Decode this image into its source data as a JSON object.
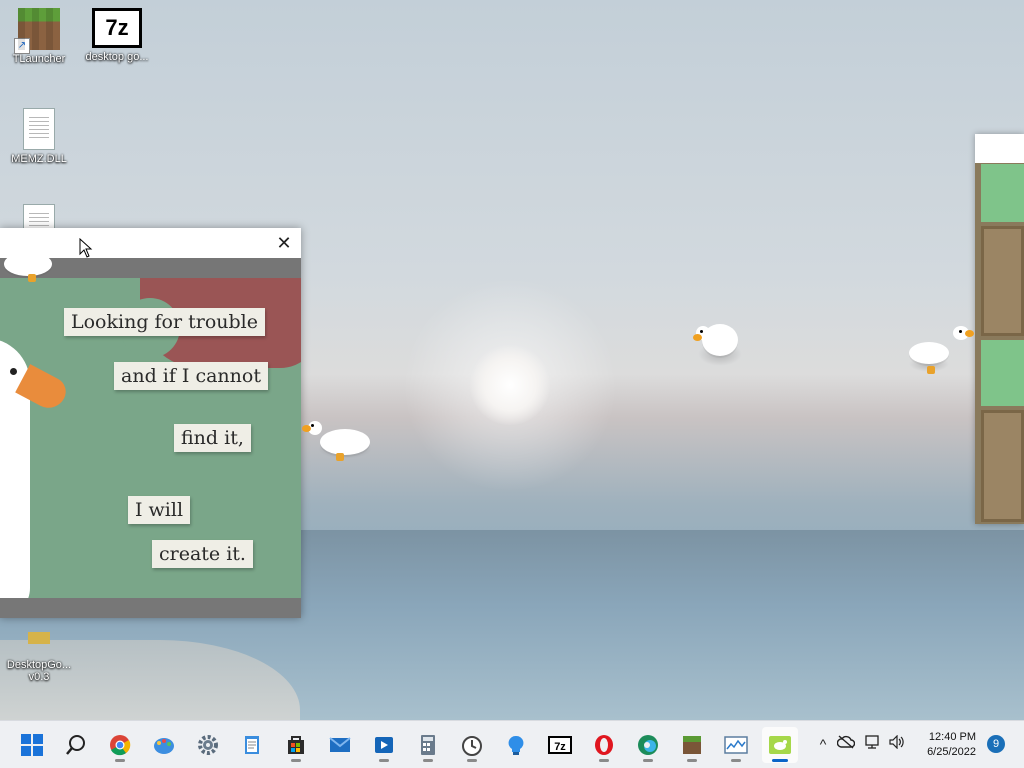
{
  "desktop": {
    "icons": [
      {
        "label": "TLauncher"
      },
      {
        "label": "desktop go..."
      },
      {
        "label": "MEMZ.DLL"
      },
      {
        "label": "DesktopGo...\nv0.3"
      }
    ]
  },
  "goose_window": {
    "close_label": "✕",
    "poster_lines": [
      "Looking for trouble",
      "and if I cannot",
      "find it,",
      "I will",
      "create it."
    ]
  },
  "taskbar": {
    "apps": [
      "start",
      "search",
      "chrome",
      "paint",
      "settings",
      "notepad",
      "store",
      "mail",
      "media",
      "calculator",
      "clock",
      "lightbulb",
      "7zip",
      "opera",
      "edge",
      "minecraft",
      "monitor",
      "goose"
    ],
    "tray": {
      "chevron": "^",
      "time": "12:40 PM",
      "date": "6/25/2022",
      "notifications": "9"
    }
  },
  "colors": {
    "accent": "#0a64c8",
    "poster_green": "#7aa689",
    "beak_orange": "#e98c3c"
  }
}
